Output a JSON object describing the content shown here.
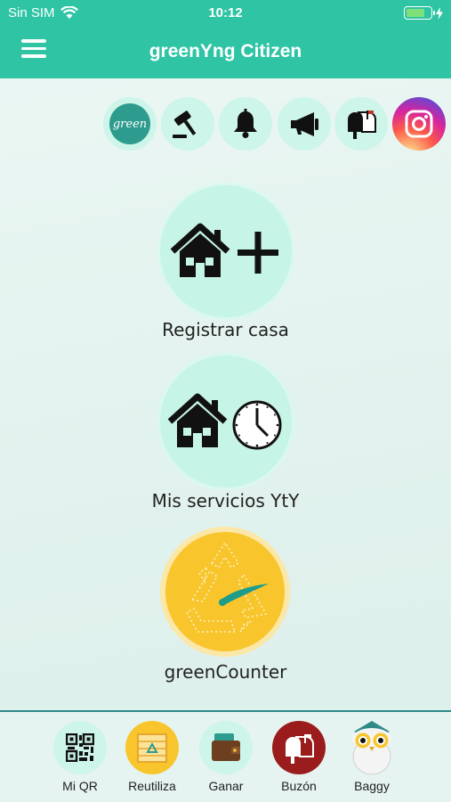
{
  "status_bar": {
    "carrier": "Sin SIM",
    "time": "10:12",
    "battery_color": "#7fe07a"
  },
  "header": {
    "title": "greenYng Citizen",
    "menu_icon": "hamburger-icon",
    "background": "#2ec4a4"
  },
  "quick_icons": [
    {
      "name": "green-logo-icon",
      "text": "green"
    },
    {
      "name": "gavel-icon"
    },
    {
      "name": "bell-icon"
    },
    {
      "name": "megaphone-icon"
    },
    {
      "name": "mailbox-icon"
    },
    {
      "name": "instagram-icon"
    }
  ],
  "actions": {
    "register_house": {
      "label": "Registrar casa",
      "icon": "house-plus-icon"
    },
    "my_services": {
      "label": "Mis servicios YtY",
      "icon": "house-clock-icon"
    },
    "green_counter": {
      "label": "greenCounter",
      "icon": "recycle-gauge-icon"
    }
  },
  "tabs": [
    {
      "label": "Mi QR",
      "icon": "qr-code-icon"
    },
    {
      "label": "Reutiliza",
      "icon": "recycle-bin-icon"
    },
    {
      "label": "Ganar",
      "icon": "wallet-icon"
    },
    {
      "label": "Buzón",
      "icon": "mailbox-icon"
    },
    {
      "label": "Baggy",
      "icon": "owl-mascot-icon"
    }
  ]
}
